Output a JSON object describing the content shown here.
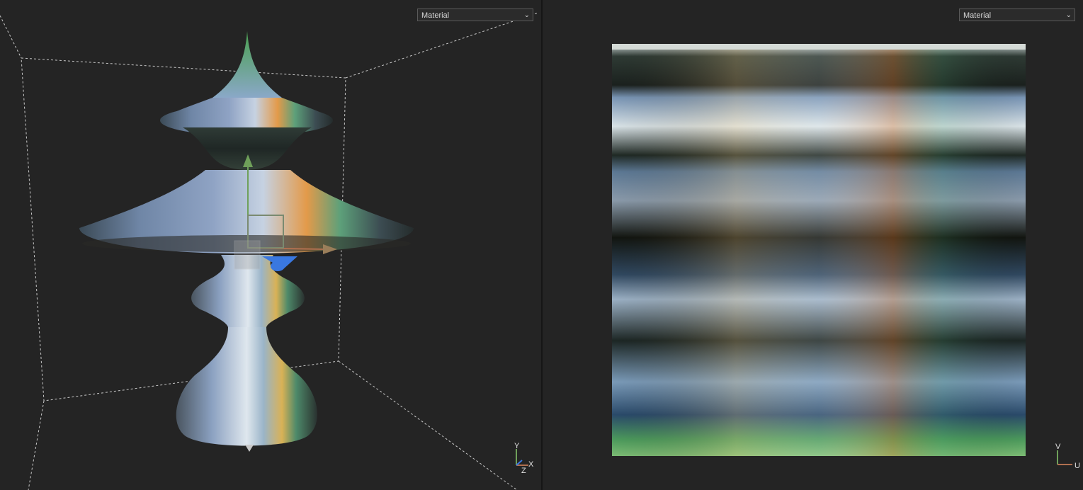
{
  "left_viewport": {
    "shading_mode": "Material",
    "axis_labels": {
      "y": "Y",
      "x": "X",
      "z": "Z"
    }
  },
  "right_viewport": {
    "shading_mode": "Material",
    "axis_labels": {
      "v": "V",
      "u": "U"
    }
  },
  "colors": {
    "background": "#242424",
    "gizmo_y": "#6fa05a",
    "gizmo_x": "#b07050",
    "gizmo_z": "#3a78e0"
  },
  "icons": [
    "chevron-down-icon",
    "move-gizmo-icon",
    "axis-indicator-icon"
  ]
}
